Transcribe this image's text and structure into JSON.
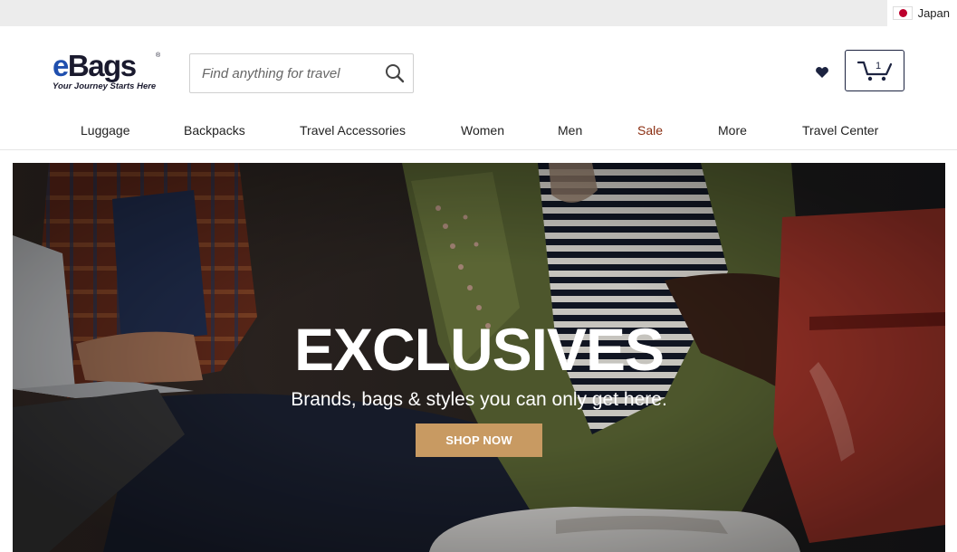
{
  "topbar": {
    "country": "Japan",
    "flag_icon": "japan-flag-icon"
  },
  "header": {
    "logo_text": "eBags",
    "logo_tagline": "Your Journey Starts Here",
    "search_placeholder": "Find anything for travel",
    "cart_count": "1",
    "icons": {
      "search": "search-icon",
      "wishlist": "heart-icon",
      "cart": "cart-icon"
    }
  },
  "nav": {
    "items": [
      "Luggage",
      "Backpacks",
      "Travel Accessories",
      "Women",
      "Men",
      "Sale",
      "More",
      "Travel Center"
    ]
  },
  "hero": {
    "title": "EXCLUSIVES",
    "subtitle": "Brands, bags & styles you can only get here.",
    "cta": "SHOP NOW"
  },
  "colors": {
    "accent": "#c89a62",
    "brand_navy": "#1c2340",
    "sale": "#8a2d10"
  }
}
